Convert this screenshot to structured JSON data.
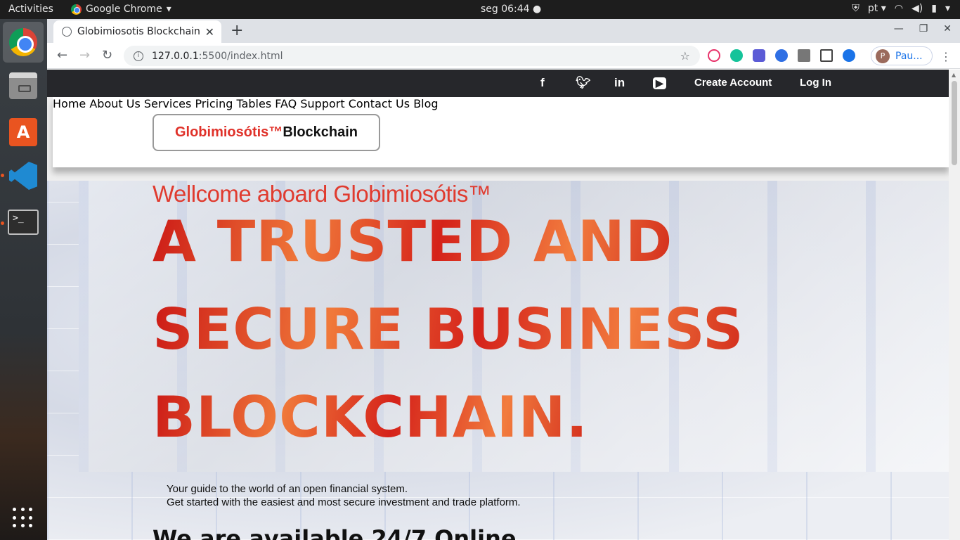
{
  "os": {
    "activities": "Activities",
    "app_name": "Google Chrome",
    "clock": "seg 06:44",
    "lang": "pt"
  },
  "browser": {
    "tab_title": "Globimiosotis Blockchain",
    "url_host": "127.0.0.1",
    "url_path": ":5500/index.html",
    "profile_name": "Pau..."
  },
  "site": {
    "top_links": {
      "create_account": "Create Account",
      "log_in": "Log In"
    },
    "social": [
      "f",
      "t",
      "in",
      "▶"
    ],
    "logo_red": "Globimiosótis™",
    "logo_black": "Blockchain",
    "nav": [
      "Home",
      "About Us",
      "Services",
      "Pricing Tables",
      "FAQ",
      "Support",
      "Contact Us",
      "Blog"
    ],
    "hero": {
      "welcome": "Wellcome aboard Globimiosótis™",
      "line1": "A TRUSTED AND",
      "line2": "SECURE BUSINESS",
      "line3": "BLOCKCHAIN.",
      "sub1": "Your guide to the world of an open financial system.",
      "sub2": "Get started with the easiest and most secure investment and trade platform.",
      "available": "We are available 24/7 Online"
    }
  },
  "colors": {
    "brand_red": "#e0322a",
    "dark_bar": "#26272b",
    "ubuntu_orange": "#e95420"
  }
}
